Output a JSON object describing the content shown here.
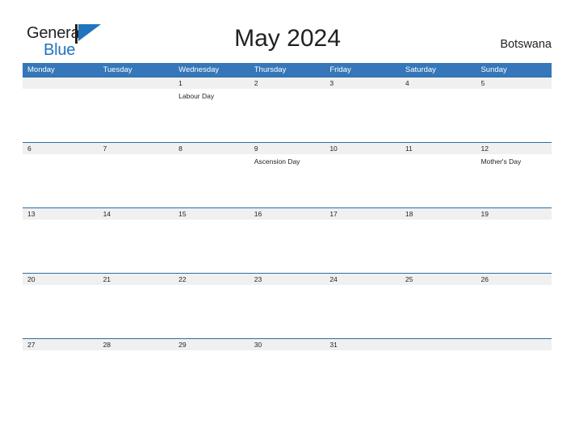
{
  "brand": {
    "name_part1": "General",
    "name_part2": "Blue",
    "flag_icon": "flag-icon",
    "accent_color": "#1f74bd"
  },
  "header": {
    "title": "May 2024",
    "country": "Botswana"
  },
  "colors": {
    "header_blue": "#3577b8",
    "row_rule_blue": "#2e6da4",
    "date_band_gray": "#f0f0f0",
    "text": "#231f20"
  },
  "calendar": {
    "weekdays": [
      "Monday",
      "Tuesday",
      "Wednesday",
      "Thursday",
      "Friday",
      "Saturday",
      "Sunday"
    ],
    "weeks": [
      {
        "days": [
          {
            "date": "",
            "event": ""
          },
          {
            "date": "",
            "event": ""
          },
          {
            "date": "1",
            "event": "Labour Day"
          },
          {
            "date": "2",
            "event": ""
          },
          {
            "date": "3",
            "event": ""
          },
          {
            "date": "4",
            "event": ""
          },
          {
            "date": "5",
            "event": ""
          }
        ]
      },
      {
        "days": [
          {
            "date": "6",
            "event": ""
          },
          {
            "date": "7",
            "event": ""
          },
          {
            "date": "8",
            "event": ""
          },
          {
            "date": "9",
            "event": "Ascension Day"
          },
          {
            "date": "10",
            "event": ""
          },
          {
            "date": "11",
            "event": ""
          },
          {
            "date": "12",
            "event": "Mother's Day"
          }
        ]
      },
      {
        "days": [
          {
            "date": "13",
            "event": ""
          },
          {
            "date": "14",
            "event": ""
          },
          {
            "date": "15",
            "event": ""
          },
          {
            "date": "16",
            "event": ""
          },
          {
            "date": "17",
            "event": ""
          },
          {
            "date": "18",
            "event": ""
          },
          {
            "date": "19",
            "event": ""
          }
        ]
      },
      {
        "days": [
          {
            "date": "20",
            "event": ""
          },
          {
            "date": "21",
            "event": ""
          },
          {
            "date": "22",
            "event": ""
          },
          {
            "date": "23",
            "event": ""
          },
          {
            "date": "24",
            "event": ""
          },
          {
            "date": "25",
            "event": ""
          },
          {
            "date": "26",
            "event": ""
          }
        ]
      },
      {
        "days": [
          {
            "date": "27",
            "event": ""
          },
          {
            "date": "28",
            "event": ""
          },
          {
            "date": "29",
            "event": ""
          },
          {
            "date": "30",
            "event": ""
          },
          {
            "date": "31",
            "event": ""
          },
          {
            "date": "",
            "event": ""
          },
          {
            "date": "",
            "event": ""
          }
        ]
      }
    ]
  }
}
